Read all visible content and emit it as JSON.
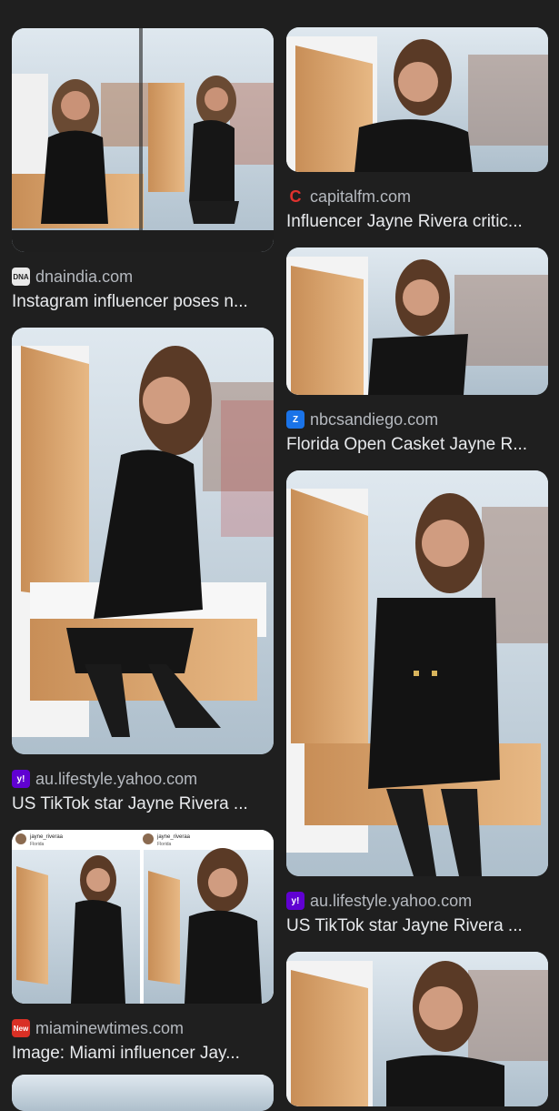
{
  "results": [
    {
      "domain": "dnaindia.com",
      "title": "Instagram influencer poses n...",
      "favicon": "DNA"
    },
    {
      "domain": "capitalfm.com",
      "title": "Influencer Jayne Rivera critic...",
      "favicon": "C"
    },
    {
      "domain": "nbcsandiego.com",
      "title": "Florida Open Casket Jayne R...",
      "favicon": "Z"
    },
    {
      "domain": "au.lifestyle.yahoo.com",
      "title": "US TikTok star Jayne Rivera ...",
      "favicon": "y!"
    },
    {
      "domain": "au.lifestyle.yahoo.com",
      "title": "US TikTok star Jayne Rivera ...",
      "favicon": "y!"
    },
    {
      "domain": "miaminewtimes.com",
      "title": "Image: Miami influencer Jay...",
      "favicon": "New"
    }
  ],
  "insta": {
    "user": "jayne_riveraa",
    "location": "Florida"
  },
  "colors": {
    "background": "#1f1f1f",
    "domain": "#b5b9bf",
    "title": "#e8eaed"
  }
}
